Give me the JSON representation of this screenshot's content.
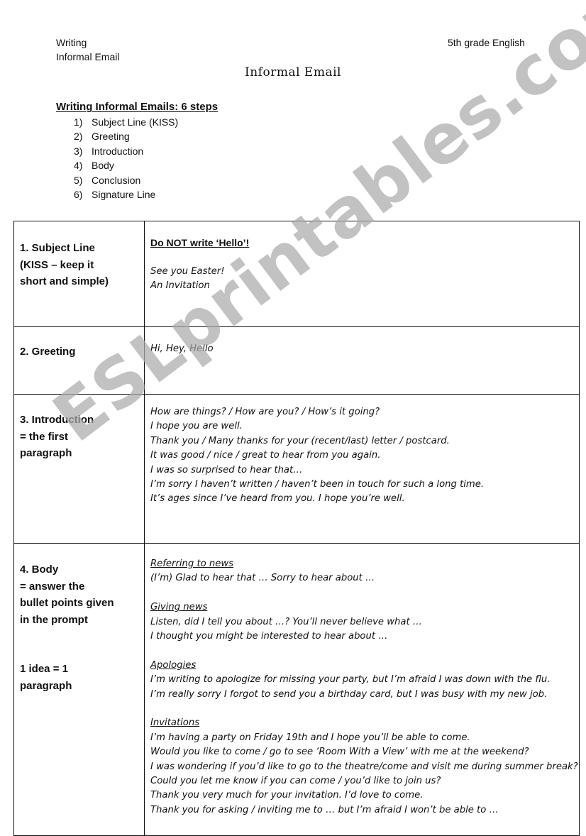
{
  "header": {
    "left_line1": "Writing",
    "left_line2": "Informal Email",
    "right": "5th grade English"
  },
  "title": "Informal Email",
  "steps": {
    "heading": "Writing Informal Emails: 6 steps",
    "items": [
      {
        "num": "1)",
        "label": "Subject Line (KISS)"
      },
      {
        "num": "2)",
        "label": "Greeting"
      },
      {
        "num": "3)",
        "label": "Introduction"
      },
      {
        "num": "4)",
        "label": "Body"
      },
      {
        "num": "5)",
        "label": "Conclusion"
      },
      {
        "num": "6)",
        "label": "Signature Line"
      }
    ]
  },
  "table": {
    "subject": {
      "label_lines": [
        "1. Subject Line",
        "(KISS – keep it",
        "short and simple)"
      ],
      "warning": "Do NOT write ‘Hello’!",
      "examples": [
        "See you Easter!",
        "An Invitation"
      ]
    },
    "greeting": {
      "label": "2. Greeting",
      "examples": "Hi, Hey, Hello"
    },
    "introduction": {
      "label_lines": [
        "3. Introduction",
        "= the first",
        "paragraph"
      ],
      "lines": [
        "How are things? / How are you? / How’s it going?",
        "I hope you are well.",
        "Thank you / Many thanks for your (recent/last) letter / postcard.",
        "It was good / nice / great to hear from you again.",
        "I was so surprised to hear that…",
        "I’m sorry I haven’t written / haven’t been in touch for such a long time.",
        "It’s ages since I’ve heard from you. I hope you’re well."
      ]
    },
    "body": {
      "label_lines": [
        "4. Body",
        "= answer the",
        "bullet points given",
        "in the prompt"
      ],
      "label_note_lines": [
        "1 idea = 1",
        "paragraph"
      ],
      "sections": [
        {
          "heading": "Referring to news",
          "lines": [
            "(I’m) Glad to hear that … Sorry to hear about …"
          ]
        },
        {
          "heading": "Giving news",
          "lines": [
            "Listen, did I tell you about …? You’ll never believe what …",
            "I thought you might be interested to hear about …"
          ]
        },
        {
          "heading": "Apologies",
          "lines": [
            "I’m writing to apologize for missing your party, but I’m afraid I was down with the flu.",
            "I’m really sorry I forgot to send you a birthday card, but I was busy with my new job."
          ]
        },
        {
          "heading": "Invitations",
          "lines": [
            "I’m having a party on Friday 19th and I hope you’ll be able to come.",
            "Would you like to come / go to see ‘Room With a View’ with me at the weekend?",
            "I was wondering if you’d like to go to the theatre/come and visit me during summer break?",
            "Could you let me know if you can come / you’d like to join us?",
            "Thank you very much for your invitation. I’d love to come.",
            "Thank you for asking / inviting me to … but I’m afraid I won’t be able to …"
          ]
        }
      ]
    }
  },
  "watermark": "ESLprintables.com"
}
